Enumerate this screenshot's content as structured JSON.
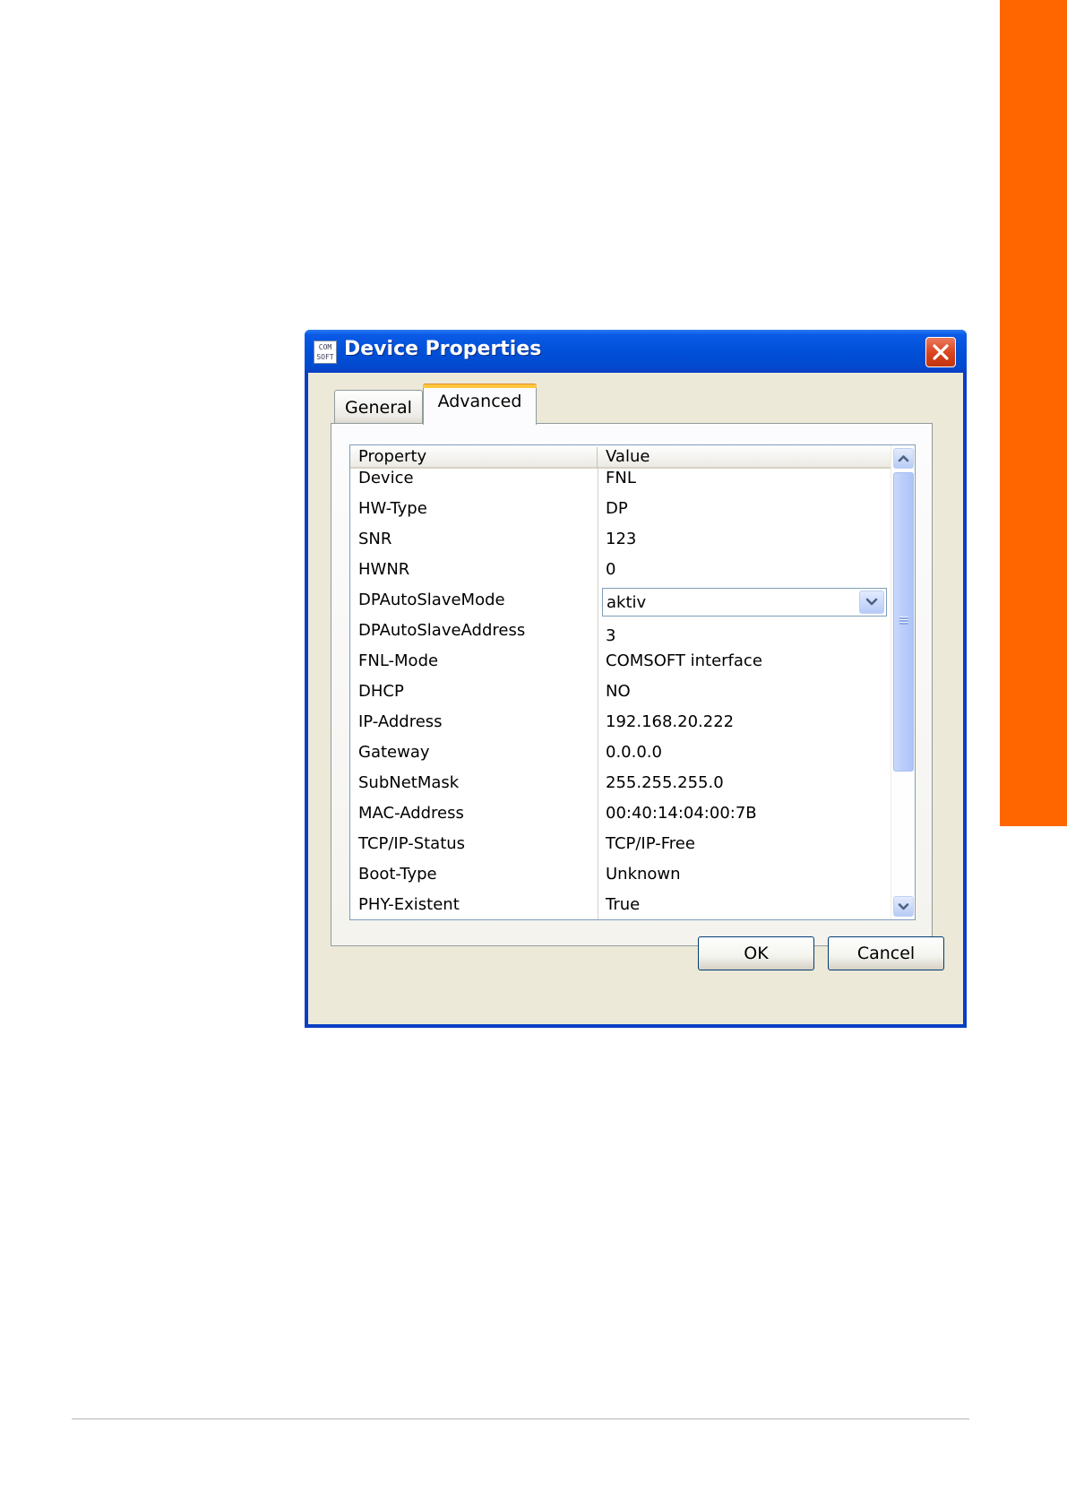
{
  "window": {
    "title": "Device Properties",
    "app_icon_text": "COM SOFT",
    "accent_color": "#0054e3",
    "close_color": "#d9421c"
  },
  "tabs": [
    {
      "label": "General",
      "selected": false
    },
    {
      "label": "Advanced",
      "selected": true
    }
  ],
  "table": {
    "headers": {
      "property": "Property",
      "value": "Value"
    },
    "rows": [
      {
        "property": "Device",
        "value": "FNL"
      },
      {
        "property": "HW-Type",
        "value": "DP"
      },
      {
        "property": "SNR",
        "value": "123"
      },
      {
        "property": "HWNR",
        "value": "0"
      },
      {
        "property": "DPAutoSlaveMode",
        "value": "aktiv",
        "control": "dropdown"
      },
      {
        "property": "DPAutoSlaveAddress",
        "value": "3"
      },
      {
        "property": "FNL-Mode",
        "value": "COMSOFT interface"
      },
      {
        "property": "DHCP",
        "value": "NO"
      },
      {
        "property": "IP-Address",
        "value": "192.168.20.222"
      },
      {
        "property": "Gateway",
        "value": "0.0.0.0"
      },
      {
        "property": "SubNetMask",
        "value": "255.255.255.0"
      },
      {
        "property": "MAC-Address",
        "value": "00:40:14:04:00:7B"
      },
      {
        "property": "TCP/IP-Status",
        "value": "TCP/IP-Free"
      },
      {
        "property": "Boot-Type",
        "value": "Unknown"
      },
      {
        "property": "PHY-Existent",
        "value": "True"
      }
    ]
  },
  "buttons": {
    "ok": "OK",
    "cancel": "Cancel"
  },
  "page": {
    "side_bar_color": "#ff6600"
  }
}
